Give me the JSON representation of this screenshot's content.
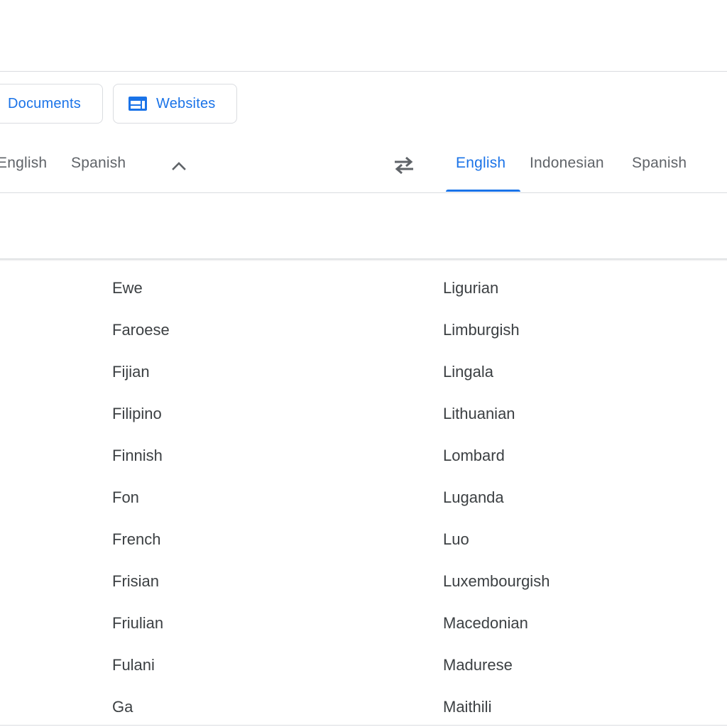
{
  "toolbar": {
    "documents_label": "Documents",
    "websites_label": "Websites"
  },
  "source_languages": {
    "tabs": [
      "English",
      "Spanish"
    ]
  },
  "target_languages": {
    "tabs": [
      "English",
      "Indonesian",
      "Spanish"
    ],
    "active": "English"
  },
  "icons": {
    "websites": "web-page-icon",
    "collapse": "chevron-up-icon",
    "swap": "swap-languages-icon"
  },
  "colors": {
    "accent": "#1a73e8",
    "text": "#3c4043",
    "muted": "#5f6368",
    "divider": "#dadce0"
  },
  "language_list": {
    "column_left": [
      "Ewe",
      "Faroese",
      "Fijian",
      "Filipino",
      "Finnish",
      "Fon",
      "French",
      "Frisian",
      "Friulian",
      "Fulani",
      "Ga"
    ],
    "column_right": [
      "Ligurian",
      "Limburgish",
      "Lingala",
      "Lithuanian",
      "Lombard",
      "Luganda",
      "Luo",
      "Luxembourgish",
      "Macedonian",
      "Madurese",
      "Maithili"
    ]
  }
}
